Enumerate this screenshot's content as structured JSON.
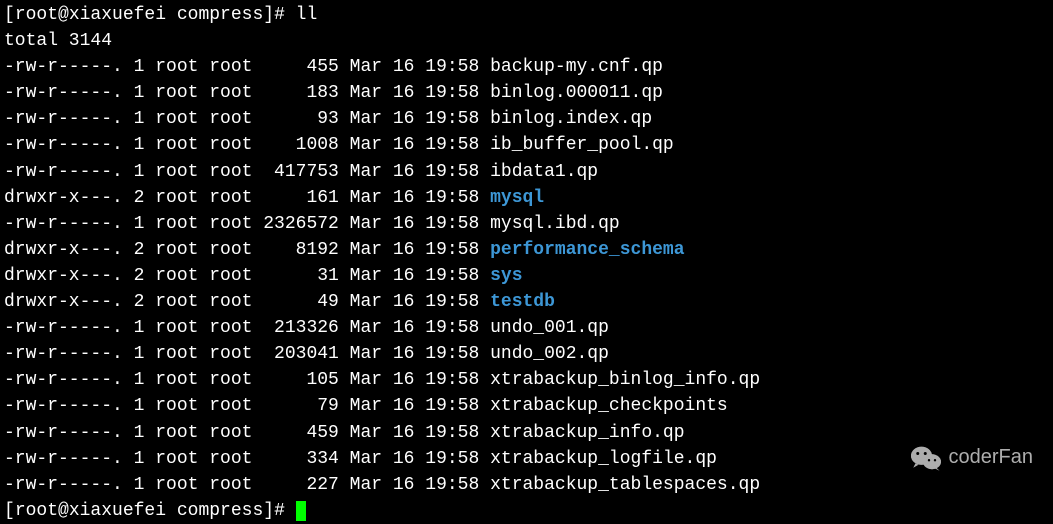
{
  "prompt1": {
    "open": "[",
    "user": "root@xiaxuefei compress",
    "close": "]# ",
    "command": "ll"
  },
  "total_line": "total 3144",
  "files": [
    {
      "perms": "-rw-r-----.",
      "links": "1",
      "owner": "root",
      "group": "root",
      "size": "455",
      "month": "Mar",
      "day": "16",
      "time": "19:58",
      "name": "backup-my.cnf.qp",
      "is_dir": false
    },
    {
      "perms": "-rw-r-----.",
      "links": "1",
      "owner": "root",
      "group": "root",
      "size": "183",
      "month": "Mar",
      "day": "16",
      "time": "19:58",
      "name": "binlog.000011.qp",
      "is_dir": false
    },
    {
      "perms": "-rw-r-----.",
      "links": "1",
      "owner": "root",
      "group": "root",
      "size": "93",
      "month": "Mar",
      "day": "16",
      "time": "19:58",
      "name": "binlog.index.qp",
      "is_dir": false
    },
    {
      "perms": "-rw-r-----.",
      "links": "1",
      "owner": "root",
      "group": "root",
      "size": "1008",
      "month": "Mar",
      "day": "16",
      "time": "19:58",
      "name": "ib_buffer_pool.qp",
      "is_dir": false
    },
    {
      "perms": "-rw-r-----.",
      "links": "1",
      "owner": "root",
      "group": "root",
      "size": "417753",
      "month": "Mar",
      "day": "16",
      "time": "19:58",
      "name": "ibdata1.qp",
      "is_dir": false
    },
    {
      "perms": "drwxr-x---.",
      "links": "2",
      "owner": "root",
      "group": "root",
      "size": "161",
      "month": "Mar",
      "day": "16",
      "time": "19:58",
      "name": "mysql",
      "is_dir": true
    },
    {
      "perms": "-rw-r-----.",
      "links": "1",
      "owner": "root",
      "group": "root",
      "size": "2326572",
      "month": "Mar",
      "day": "16",
      "time": "19:58",
      "name": "mysql.ibd.qp",
      "is_dir": false
    },
    {
      "perms": "drwxr-x---.",
      "links": "2",
      "owner": "root",
      "group": "root",
      "size": "8192",
      "month": "Mar",
      "day": "16",
      "time": "19:58",
      "name": "performance_schema",
      "is_dir": true
    },
    {
      "perms": "drwxr-x---.",
      "links": "2",
      "owner": "root",
      "group": "root",
      "size": "31",
      "month": "Mar",
      "day": "16",
      "time": "19:58",
      "name": "sys",
      "is_dir": true
    },
    {
      "perms": "drwxr-x---.",
      "links": "2",
      "owner": "root",
      "group": "root",
      "size": "49",
      "month": "Mar",
      "day": "16",
      "time": "19:58",
      "name": "testdb",
      "is_dir": true
    },
    {
      "perms": "-rw-r-----.",
      "links": "1",
      "owner": "root",
      "group": "root",
      "size": "213326",
      "month": "Mar",
      "day": "16",
      "time": "19:58",
      "name": "undo_001.qp",
      "is_dir": false
    },
    {
      "perms": "-rw-r-----.",
      "links": "1",
      "owner": "root",
      "group": "root",
      "size": "203041",
      "month": "Mar",
      "day": "16",
      "time": "19:58",
      "name": "undo_002.qp",
      "is_dir": false
    },
    {
      "perms": "-rw-r-----.",
      "links": "1",
      "owner": "root",
      "group": "root",
      "size": "105",
      "month": "Mar",
      "day": "16",
      "time": "19:58",
      "name": "xtrabackup_binlog_info.qp",
      "is_dir": false
    },
    {
      "perms": "-rw-r-----.",
      "links": "1",
      "owner": "root",
      "group": "root",
      "size": "79",
      "month": "Mar",
      "day": "16",
      "time": "19:58",
      "name": "xtrabackup_checkpoints",
      "is_dir": false
    },
    {
      "perms": "-rw-r-----.",
      "links": "1",
      "owner": "root",
      "group": "root",
      "size": "459",
      "month": "Mar",
      "day": "16",
      "time": "19:58",
      "name": "xtrabackup_info.qp",
      "is_dir": false
    },
    {
      "perms": "-rw-r-----.",
      "links": "1",
      "owner": "root",
      "group": "root",
      "size": "334",
      "month": "Mar",
      "day": "16",
      "time": "19:58",
      "name": "xtrabackup_logfile.qp",
      "is_dir": false
    },
    {
      "perms": "-rw-r-----.",
      "links": "1",
      "owner": "root",
      "group": "root",
      "size": "227",
      "month": "Mar",
      "day": "16",
      "time": "19:58",
      "name": "xtrabackup_tablespaces.qp",
      "is_dir": false
    }
  ],
  "prompt2": {
    "open": "[",
    "user": "root@xiaxuefei compress",
    "close": "]# "
  },
  "watermark": "coderFan"
}
